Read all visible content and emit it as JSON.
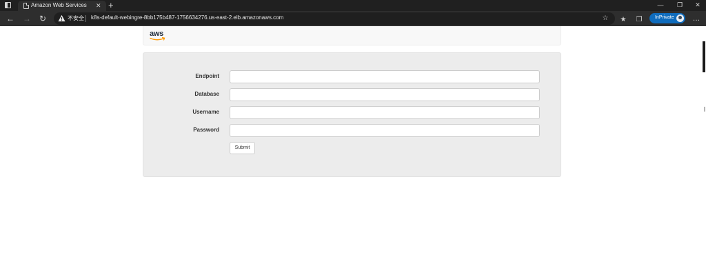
{
  "browser": {
    "tab_title": "Amazon Web Services",
    "tab_close": "✕",
    "new_tab": "+",
    "security_label": "不安全",
    "url": "k8s-default-webingre-8bb175b487-1756634276.us-east-2.elb.amazonaws.com",
    "inprivate_label": "InPrivate",
    "window_minimize": "—",
    "window_restore": "❐",
    "window_close": "✕",
    "more": "…"
  },
  "page": {
    "logo_text": "aws",
    "accent_color": "#ff9900",
    "form": {
      "fields": [
        {
          "label": "Endpoint",
          "value": ""
        },
        {
          "label": "Database",
          "value": ""
        },
        {
          "label": "Username",
          "value": ""
        },
        {
          "label": "Password",
          "value": ""
        }
      ],
      "submit_label": "Submit"
    }
  }
}
